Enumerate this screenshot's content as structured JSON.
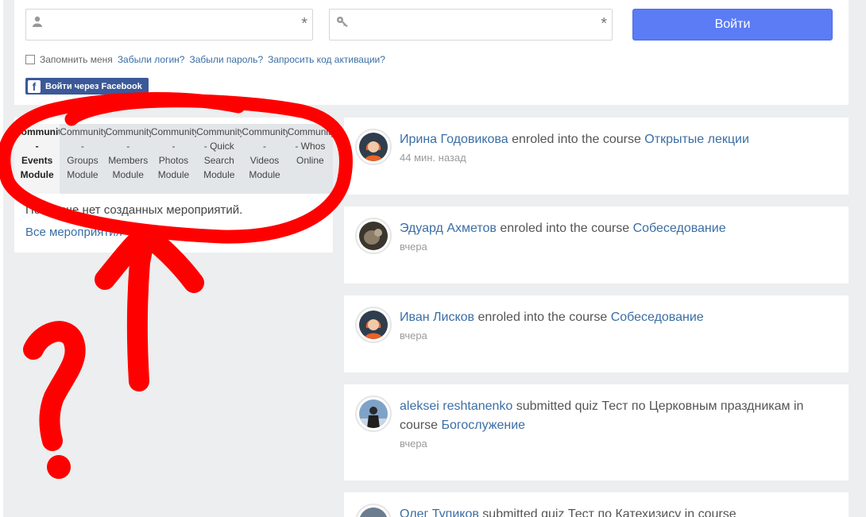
{
  "login": {
    "username_placeholder": "",
    "password_placeholder": "",
    "required_mark": "*",
    "login_button": "Войти",
    "remember_label": "Запомнить меня",
    "forgot_login": "Забыли логин?",
    "forgot_password": "Забыли пароль?",
    "request_activation": "Запросить код активации?",
    "facebook_button": "Войти через Facebook",
    "facebook_logo": "f"
  },
  "module": {
    "tabs": [
      {
        "line1": "Community",
        "line2": "-",
        "line3": "Events",
        "line4": "Module"
      },
      {
        "line1": "Community",
        "line2": "-",
        "line3": "Groups",
        "line4": "Module"
      },
      {
        "line1": "Community",
        "line2": "-",
        "line3": "Members",
        "line4": "Module"
      },
      {
        "line1": "Community",
        "line2": "-",
        "line3": "Photos",
        "line4": "Module"
      },
      {
        "line1": "Community",
        "line2": "- Quick",
        "line3": "Search",
        "line4": "Module"
      },
      {
        "line1": "Community",
        "line2": "-",
        "line3": "Videos",
        "line4": "Module"
      },
      {
        "line1": "Community",
        "line2": "- Whos",
        "line3": "Online",
        "line4": ""
      }
    ],
    "empty_message": "Пока еще нет созданных мероприятий.",
    "all_events_link": "Все мероприятия"
  },
  "feed": [
    {
      "user": "Ирина Годовикова",
      "action": " enroled into the course ",
      "target": "Открытые лекции",
      "extra": "",
      "time": "44 мин. назад"
    },
    {
      "user": "Эдуард Ахметов",
      "action": " enroled into the course ",
      "target": "Собеседование",
      "extra": "",
      "time": "вчера"
    },
    {
      "user": "Иван Лисков",
      "action": " enroled into the course ",
      "target": "Собеседование",
      "extra": "",
      "time": "вчера"
    },
    {
      "user": "aleksei reshtanenko",
      "action": " submitted quiz Тест по Церковным праздникам in course ",
      "target": "Богослужение",
      "extra": "",
      "time": "вчера"
    },
    {
      "user": "Олег Тупиков",
      "action": " submitted quiz Тест по Катехизису in course",
      "target": "",
      "extra": "",
      "time": ""
    }
  ],
  "icons": {
    "user": "user-icon",
    "key": "key-icon",
    "facebook": "facebook-icon"
  },
  "colors": {
    "accent_button": "#5b7cf5",
    "link": "#3b6ea5",
    "facebook": "#3b5998",
    "annotation": "#ff0000"
  }
}
